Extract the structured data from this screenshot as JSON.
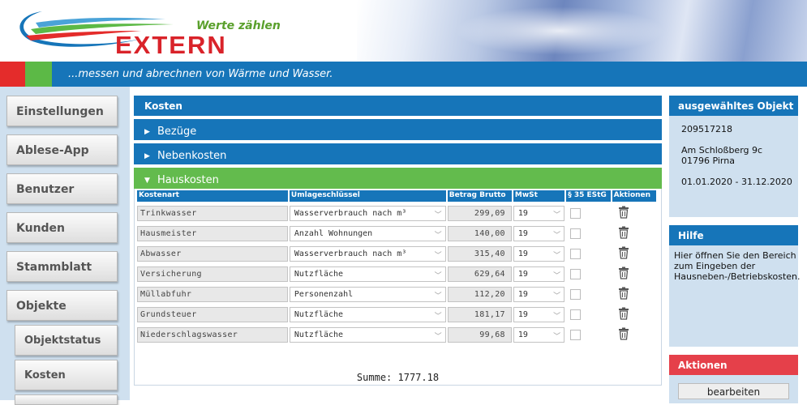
{
  "brand": {
    "tagline": "Werte zählen",
    "name": "EXTERN",
    "slogan": "...messen und abrechnen von Wärme und Wasser.",
    "colors": {
      "blue": "#1675b9",
      "red": "#e42c2b",
      "green": "#5cb946",
      "accent_green": "#63bb4d"
    }
  },
  "nav": {
    "items": [
      "Einstellungen",
      "Ablese-App",
      "Benutzer",
      "Kunden",
      "Stammblatt",
      "Objekte"
    ],
    "sub_items": [
      "Objektstatus",
      "Kosten"
    ]
  },
  "main": {
    "title": "Kosten",
    "sections": [
      {
        "label": "Bezüge",
        "state": "collapsed"
      },
      {
        "label": "Nebenkosten",
        "state": "collapsed"
      },
      {
        "label": "Hauskosten",
        "state": "expanded"
      }
    ],
    "table": {
      "headers": [
        "Kostenart",
        "Umlageschlüssel",
        "Betrag Brutto",
        "MwSt",
        "§ 35 EStG",
        "Aktionen"
      ],
      "rows": [
        {
          "kostenart": "Trinkwasser",
          "umlage": "Wasserverbrauch nach m³",
          "betrag": "299,09",
          "mwst": "19"
        },
        {
          "kostenart": "Hausmeister",
          "umlage": "Anzahl Wohnungen",
          "betrag": "140,00",
          "mwst": "19"
        },
        {
          "kostenart": "Abwasser",
          "umlage": "Wasserverbrauch nach m³",
          "betrag": "315,40",
          "mwst": "19"
        },
        {
          "kostenart": "Versicherung",
          "umlage": "Nutzfläche",
          "betrag": "629,64",
          "mwst": "19"
        },
        {
          "kostenart": "Müllabfuhr",
          "umlage": "Personenzahl",
          "betrag": "112,20",
          "mwst": "19"
        },
        {
          "kostenart": "Grundsteuer",
          "umlage": "Nutzfläche",
          "betrag": "181,17",
          "mwst": "19"
        },
        {
          "kostenart": "Niederschlagswasser",
          "umlage": "Nutzfläche",
          "betrag": "99,68",
          "mwst": "19"
        }
      ]
    },
    "summe": "Summe: 1777.18"
  },
  "right": {
    "objekt": {
      "title": "ausgewähltes Objekt",
      "id": "209517218",
      "street": "Am Schloßberg 9c",
      "city": "01796 Pirna",
      "period": "01.01.2020 - 31.12.2020"
    },
    "hilfe": {
      "title": "Hilfe",
      "text": "Hier öffnen Sie den Bereich zum Eingeben der Hausneben-/Betriebskosten."
    },
    "aktionen": {
      "title": "Aktionen",
      "button": "bearbeiten"
    }
  }
}
